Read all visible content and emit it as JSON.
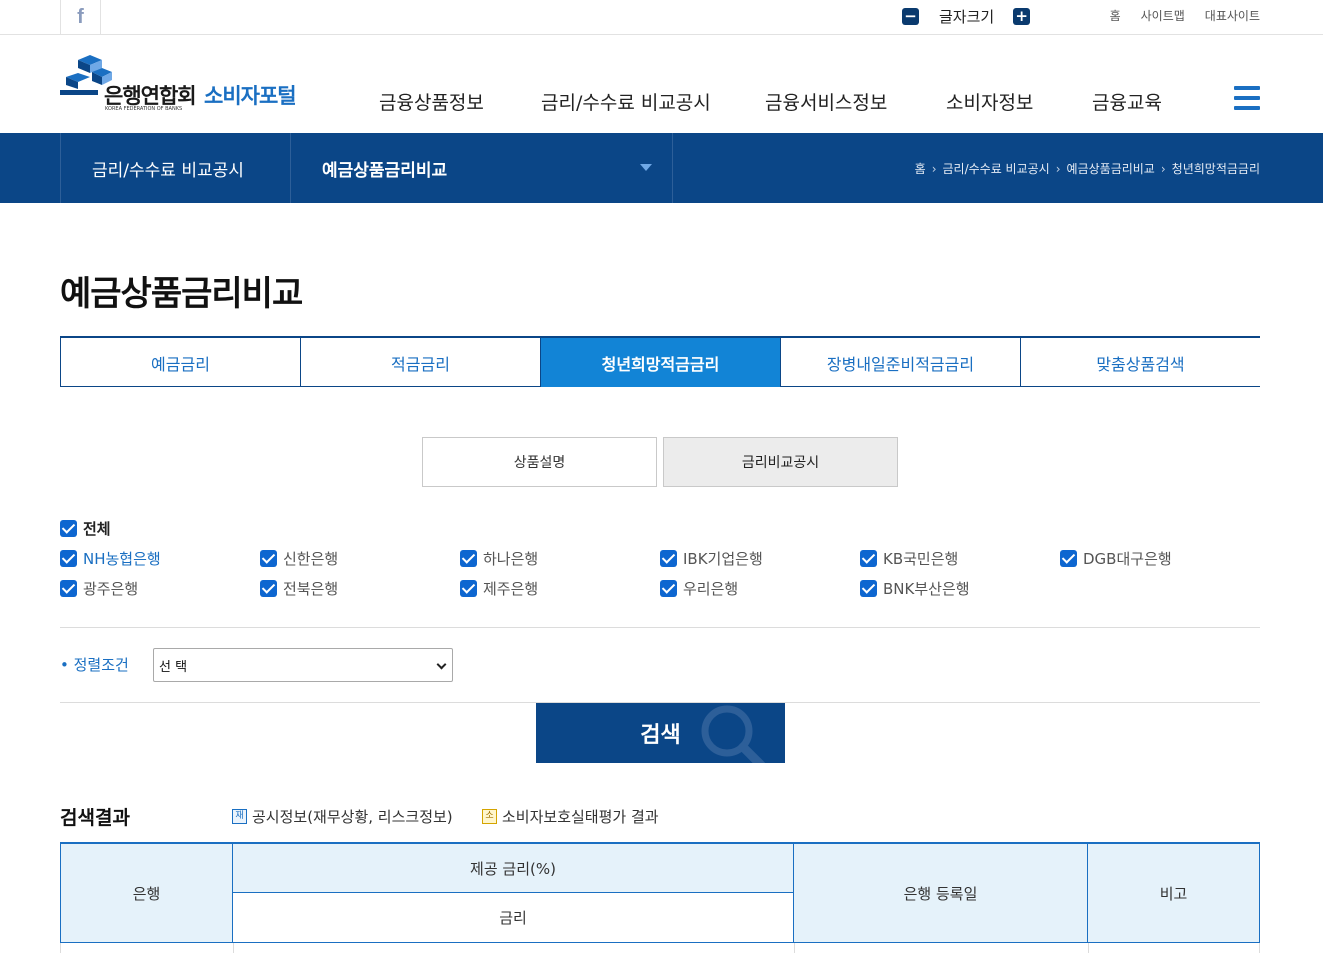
{
  "topbar": {
    "facebook_glyph": "f",
    "font_size_label": "글자크기",
    "decrease_glyph": "−",
    "increase_glyph": "+",
    "links": [
      "홈",
      "사이트맵",
      "대표사이트"
    ]
  },
  "header": {
    "logo_name": "은행연합회",
    "logo_sub": "KOREA FEDERATION OF BANKS",
    "portal_name": "소비자포털",
    "gnb": [
      "금융상품정보",
      "금리/수수료 비교공시",
      "금융서비스정보",
      "소비자정보",
      "금융교육"
    ]
  },
  "subnav": {
    "section": "금리/수수료 비교공시",
    "current": "예금상품금리비교",
    "breadcrumb": [
      "홈",
      "금리/수수료 비교공시",
      "예금상품금리비교",
      "청년희망적금금리"
    ]
  },
  "page_title": "예금상품금리비교",
  "tabs": [
    {
      "label": "예금금리",
      "active": false
    },
    {
      "label": "적금금리",
      "active": false
    },
    {
      "label": "청년희망적금금리",
      "active": true
    },
    {
      "label": "장병내일준비적금금리",
      "active": false
    },
    {
      "label": "맞춤상품검색",
      "active": false
    }
  ],
  "segments": [
    "상품설명",
    "금리비교공시"
  ],
  "banks": {
    "all_label": "전체",
    "row1": [
      "NH농협은행",
      "신한은행",
      "하나은행",
      "IBK기업은행",
      "KB국민은행",
      "DGB대구은행"
    ],
    "row2": [
      "광주은행",
      "전북은행",
      "제주은행",
      "우리은행",
      "BNK부산은행"
    ]
  },
  "sort": {
    "label": "정렬조건",
    "selected": "선 택"
  },
  "search_label": "검색",
  "results": {
    "title": "검색결과",
    "legend1_badge": "재",
    "legend1": "공시정보(재무상황, 리스크정보)",
    "legend2_badge": "소",
    "legend2": "소비자보호실태평가 결과"
  },
  "table": {
    "col_bank": "은행",
    "col_rate_group": "제공 금리(%)",
    "col_rate": "금리",
    "col_date": "은행 등록일",
    "col_note": "비고"
  },
  "colors": {
    "navy": "#0b4687",
    "accent_blue": "#1a6fc2",
    "active_tab": "#1284d6",
    "checkbox": "#0d66d0",
    "table_header_bg": "#e5f2fa"
  }
}
